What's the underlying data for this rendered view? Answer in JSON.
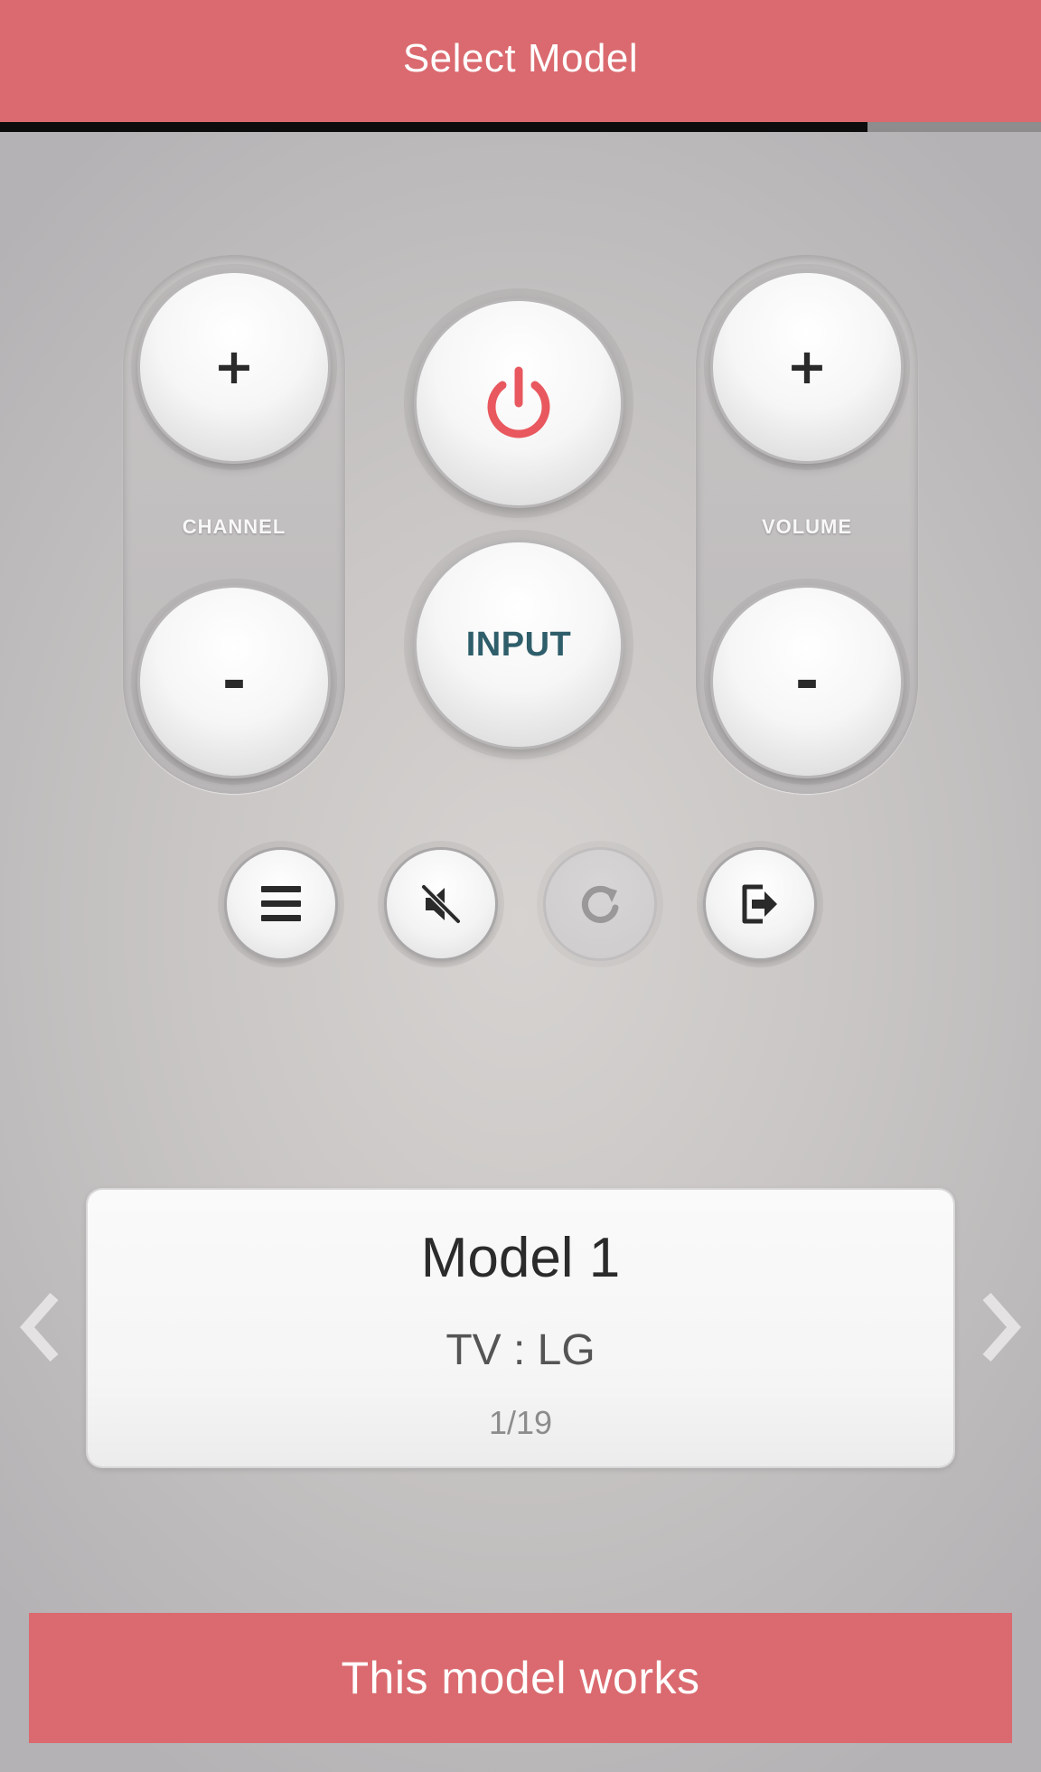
{
  "header": {
    "title": "Select Model",
    "progress": 0.833
  },
  "remote": {
    "channel_label": "CHANNEL",
    "volume_label": "VOLUME",
    "channel_up_symbol": "+",
    "channel_down_symbol": "-",
    "volume_up_symbol": "+",
    "volume_down_symbol": "-",
    "input_label": "INPUT",
    "power_icon": "power-icon",
    "power_color": "#e8585e",
    "small_buttons": [
      {
        "icon": "menu-icon",
        "enabled": true
      },
      {
        "icon": "mute-icon",
        "enabled": true
      },
      {
        "icon": "refresh-icon",
        "enabled": false
      },
      {
        "icon": "exit-icon",
        "enabled": true
      }
    ]
  },
  "model_card": {
    "name": "Model 1",
    "brand": "TV : LG",
    "count": "1/19"
  },
  "bottom": {
    "works_label": "This model works"
  },
  "colors": {
    "accent": "#da6a6f",
    "input_text": "#2f5e6b"
  }
}
